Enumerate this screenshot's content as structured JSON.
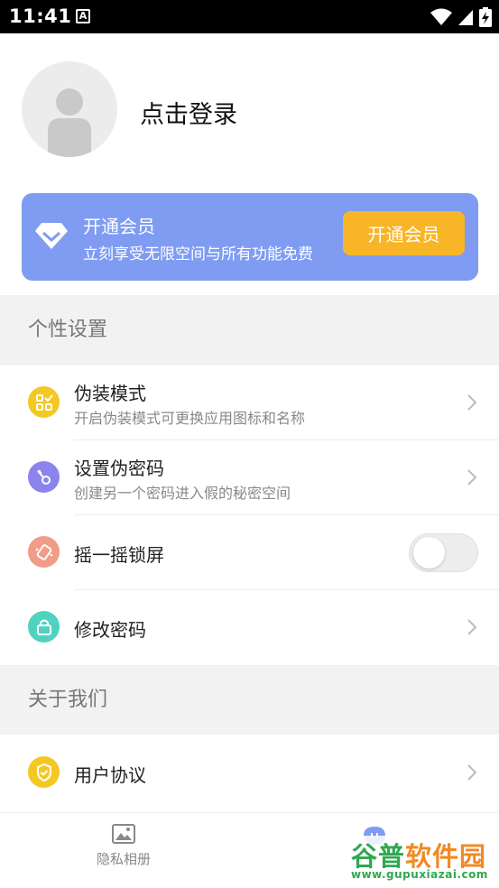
{
  "status_bar": {
    "time": "11:41",
    "notification_glyph": "A",
    "icons": [
      "wifi-icon",
      "signal-icon",
      "battery-charging-icon"
    ]
  },
  "profile": {
    "login_text": "点击登录",
    "avatar_icon": "user-placeholder-icon"
  },
  "vip": {
    "title": "开通会员",
    "subtitle": "立刻享受无限空间与所有功能免费",
    "button_label": "开通会员",
    "icon": "diamond-icon",
    "card_color": "#7f9cf2",
    "button_color": "#f8b527"
  },
  "sections": {
    "personal": "个性设置",
    "about": "关于我们"
  },
  "settings": [
    {
      "title": "伪装模式",
      "subtitle": "开启伪装模式可更换应用图标和名称",
      "icon": "apps-check-icon",
      "color": "#f3c823",
      "control": "chevron"
    },
    {
      "title": "设置伪密码",
      "subtitle": "创建另一个密码进入假的秘密空间",
      "icon": "key-icon",
      "color": "#8b84ee",
      "control": "chevron"
    },
    {
      "title": "摇一摇锁屏",
      "subtitle": "",
      "icon": "shake-phone-icon",
      "color": "#f09c86",
      "control": "toggle"
    },
    {
      "title": "修改密码",
      "subtitle": "",
      "icon": "lock-icon",
      "color": "#4fd3bf",
      "control": "chevron"
    }
  ],
  "about": [
    {
      "title": "用户协议",
      "icon": "shield-check-icon",
      "color": "#f3c823",
      "control": "chevron"
    }
  ],
  "toggle_state": "off",
  "bottom_nav": {
    "items": [
      {
        "label": "隐私相册",
        "icon": "image-icon"
      },
      {
        "label": "",
        "icon": "chat-bubble-icon"
      }
    ]
  },
  "watermark": {
    "title_part1": "谷普",
    "title_part2": "软件园",
    "url": "www.gupuxiazai.com"
  }
}
